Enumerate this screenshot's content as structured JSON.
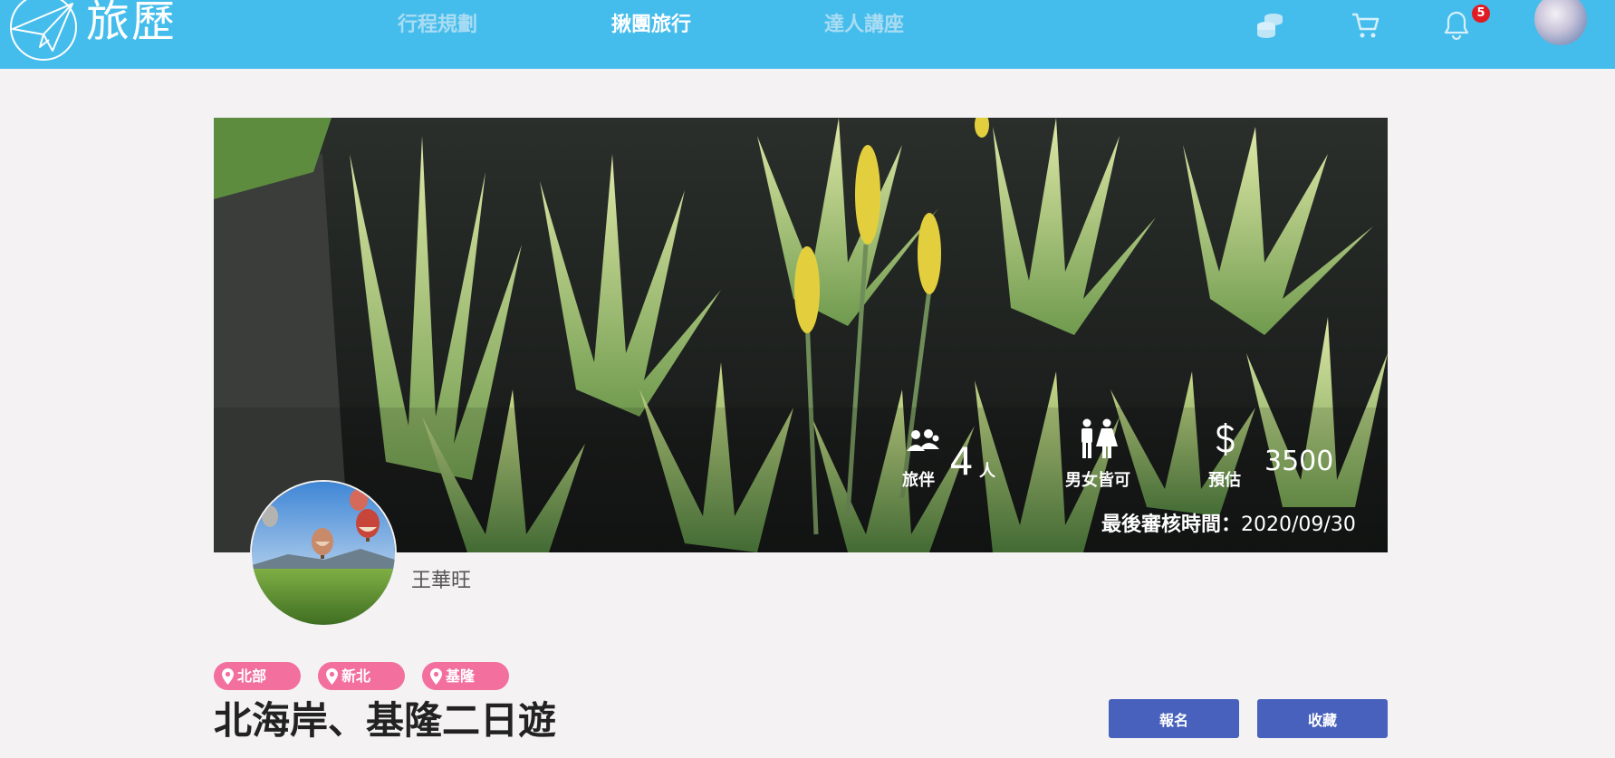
{
  "header": {
    "brand": "旅歷",
    "nav": [
      {
        "label": "行程規劃",
        "active": false
      },
      {
        "label": "揪團旅行",
        "active": true
      },
      {
        "label": "達人講座",
        "active": false
      }
    ],
    "icons": [
      "coins-icon",
      "cart-icon",
      "bell-icon"
    ],
    "notification_count": "5",
    "color": "#45bdec"
  },
  "trip": {
    "stats": {
      "companion_count": "4",
      "companion_unit": "人",
      "companion_label": "旅伴",
      "gender_label": "男女皆可",
      "estimate_label": "預估",
      "estimate_value": "3500"
    },
    "review_label": "最後審核時間：",
    "review_date": "2020/09/30",
    "organizer": "王華旺",
    "tags": [
      "北部",
      "新北",
      "基隆"
    ],
    "title": "北海岸、基隆二日遊",
    "actions": {
      "signup": "報名",
      "save": "收藏"
    }
  },
  "colors": {
    "tag": "#f26f9e",
    "button": "#4761bc",
    "badge": "#e01b24"
  }
}
